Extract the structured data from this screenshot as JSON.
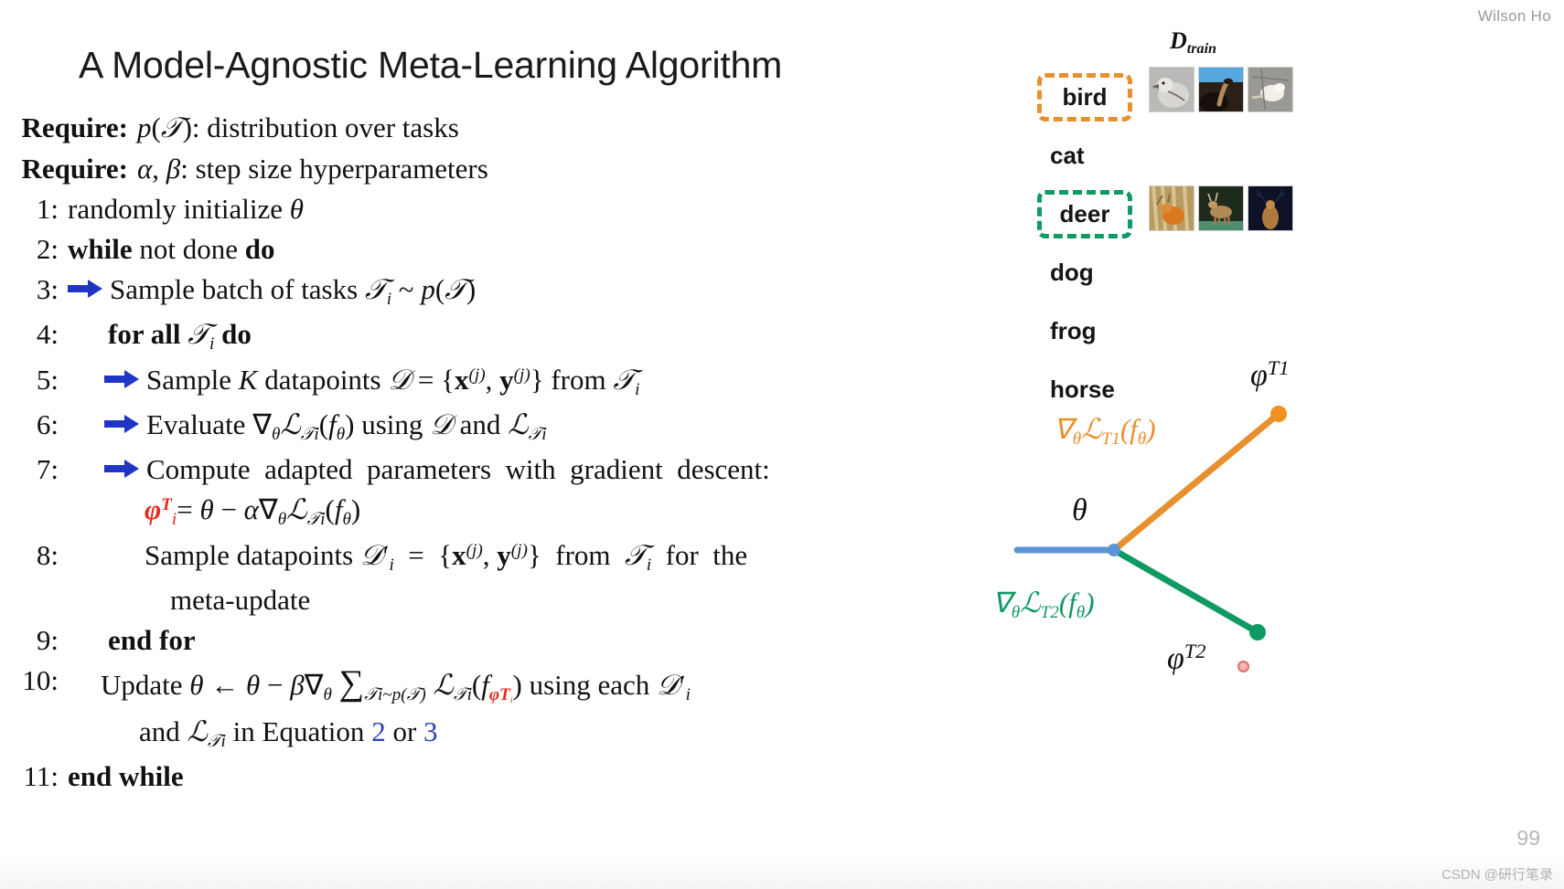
{
  "presenter": "Wilson Ho",
  "title": "A Model-Agnostic Meta-Learning Algorithm",
  "page_number": "99",
  "watermark": "CSDN @研行笔录",
  "colors": {
    "arrow_blue": "#1f35c4",
    "orange": "#e8902f",
    "green": "#0f9a62",
    "blue_line": "#5b93d6",
    "red": "#e8261b",
    "equation_ref_blue": "#2a3fb0"
  },
  "algorithm": {
    "requires": [
      {
        "label": "Require:",
        "text": "p(T): distribution over tasks"
      },
      {
        "label": "Require:",
        "text": "α, β: step size hyperparameters"
      }
    ],
    "lines": [
      {
        "num": "1:",
        "text": "randomly initialize θ",
        "marker": "none"
      },
      {
        "num": "2:",
        "text": "while not done do",
        "marker": "none"
      },
      {
        "num": "3:",
        "text": "Sample batch of tasks T_i ~ p(T)",
        "marker": "blue-arrow"
      },
      {
        "num": "4:",
        "text": "for all T_i do",
        "marker": "none"
      },
      {
        "num": "5:",
        "text": "Sample K datapoints D = {x^(j), y^(j)} from T_i",
        "marker": "blue-arrow"
      },
      {
        "num": "6:",
        "text": "Evaluate ∇_θ L_{T_i}(f_θ) using D and L_{T_i}",
        "marker": "blue-arrow"
      },
      {
        "num": "7:",
        "text": "Compute adapted parameters with gradient descent:",
        "marker": "blue-arrow"
      },
      {
        "num": "",
        "text": "φ^{T_i} = θ − α ∇_θ L_{T_i}(f_θ)",
        "marker": "none"
      },
      {
        "num": "8:",
        "text": "Sample datapoints D'_i = {x^(j), y^(j)} from T_i for the",
        "marker": "none"
      },
      {
        "num": "",
        "text": "meta-update",
        "marker": "none"
      },
      {
        "num": "9:",
        "text": "end for",
        "marker": "none"
      },
      {
        "num": "10:",
        "text": "Update θ ← θ − β ∇_θ Σ_{T_i~p(T)} L_{T_i}(f_{φ^{T_i}}) using each D'_i",
        "marker": "none"
      },
      {
        "num": "",
        "text": "and L_{T_i} in Equation 2 or 3",
        "marker": "none"
      },
      {
        "num": "11:",
        "text": "end while",
        "marker": "none"
      }
    ],
    "equation_refs": [
      "2",
      "3"
    ]
  },
  "dataset": {
    "title": "D",
    "title_sub": "train",
    "classes": [
      {
        "name": "bird",
        "highlight": "orange",
        "has_images": true
      },
      {
        "name": "cat",
        "highlight": "none",
        "has_images": false
      },
      {
        "name": "deer",
        "highlight": "green",
        "has_images": true
      },
      {
        "name": "dog",
        "highlight": "none",
        "has_images": false
      },
      {
        "name": "frog",
        "highlight": "none",
        "has_images": false
      },
      {
        "name": "horse",
        "highlight": "none",
        "has_images": false
      }
    ]
  },
  "diagram": {
    "theta_label": "θ",
    "phi1_label": "φ",
    "phi1_sup": "T1",
    "phi2_label": "φ",
    "phi2_sup": "T2",
    "grad1_label": "∇",
    "grad1_sub": "θ",
    "grad1_rest": "L",
    "grad1_task": "T1",
    "grad1_tail": "(f",
    "grad1_theta": "θ",
    "grad1_close": ")",
    "grad2_task": "T2"
  }
}
